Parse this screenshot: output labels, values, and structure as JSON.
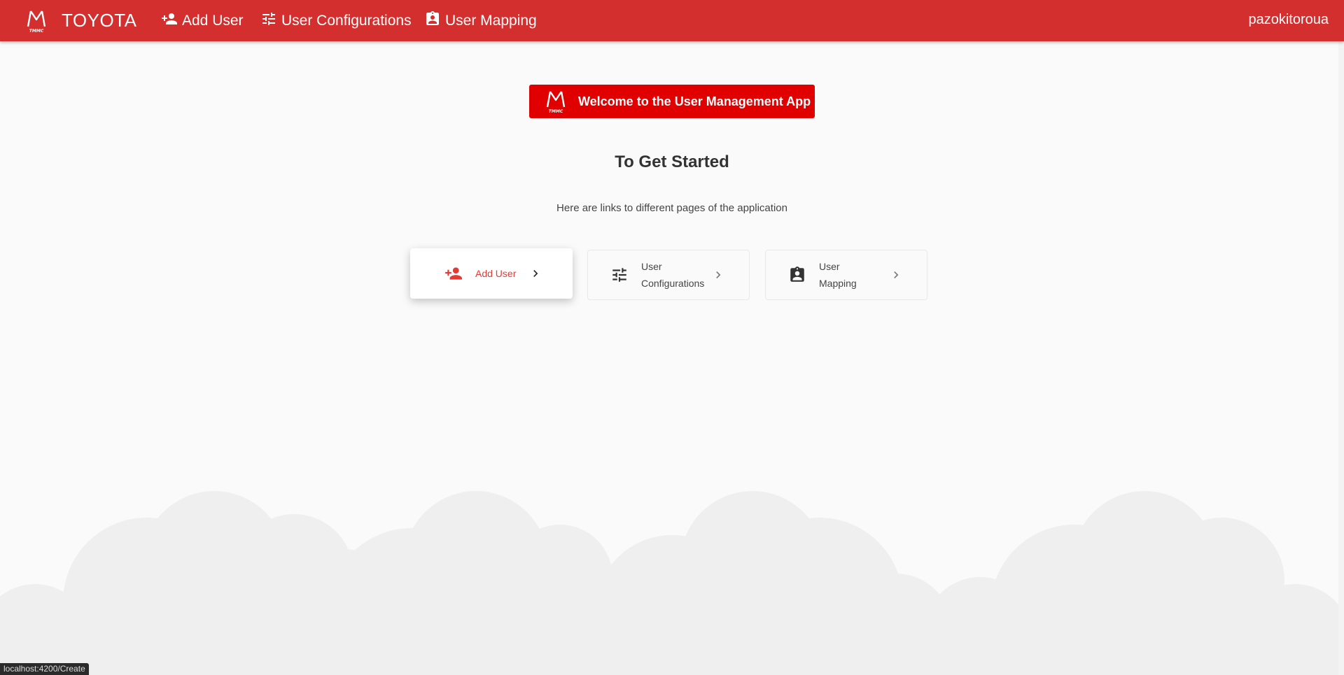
{
  "toolbar": {
    "brand": "TOYOTA",
    "logo_text": "TMMC",
    "nav": {
      "add_user": "Add User",
      "user_configurations": "User Configurations",
      "user_mapping": "User Mapping"
    },
    "username": "pazokitoroua",
    "background_color": "#d32f2f"
  },
  "banner": {
    "text": "Welcome to the User Management App",
    "background_color": "#e00000"
  },
  "main": {
    "heading": "To Get Started",
    "subtext": "Here are links to different pages of the application",
    "cards": [
      {
        "label": "Add User",
        "icon": "person-add-icon",
        "active": true
      },
      {
        "label_line1": "User",
        "label_line2": "Configurations",
        "icon": "tune-icon",
        "active": false
      },
      {
        "label_line1": "User",
        "label_line2": "Mapping",
        "icon": "assignment-ind-icon",
        "active": false
      }
    ]
  },
  "status_bar": {
    "url": "localhost:4200/Create"
  },
  "colors": {
    "accent": "#e53935",
    "cloud": "#efefef"
  }
}
